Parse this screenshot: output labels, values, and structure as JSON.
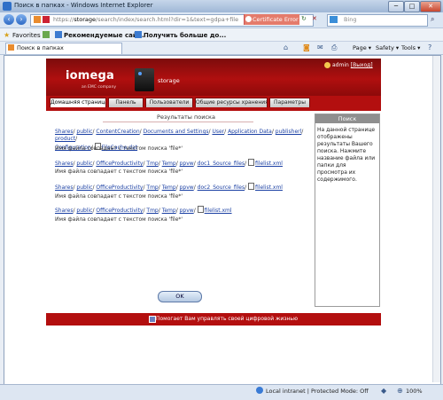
{
  "window": {
    "title": "Поиск в папках - Windows Internet Explorer",
    "minimize": "─",
    "maximize": "□",
    "close": "✕"
  },
  "address_bar": {
    "url_prefix": "https://",
    "url_host": "storage",
    "url_rest": "/search/index/search.html?dir=1&text=gdpa+file",
    "cert_error": "Certificate Error",
    "search_placeholder": "Bing"
  },
  "favorites_bar": {
    "favorites": "Favorites",
    "item1": "Рекомендуемые сай...",
    "item2": "Получить больше до..."
  },
  "tab": {
    "title": "Поиск в папках"
  },
  "toolbar_right": {
    "page": "Page ▾",
    "safety": "Safety ▾",
    "tools": "Tools ▾"
  },
  "header": {
    "logo": "iomega",
    "logo_sub": "an EMC company",
    "device_name": "storage",
    "user": "admin",
    "logout": "[Выход]"
  },
  "nav_tabs": [
    "Домашняя страница",
    "Панель",
    "Пользователи",
    "Общие ресурсы хранения",
    "Параметры"
  ],
  "results": {
    "title": "Результаты поиска",
    "match_text": "Имя файла совпадает с текстом поиска 'file*'",
    "r1_line1": [
      "Shares",
      "public",
      "ContentCreation",
      "Documents and Settings",
      "User",
      "Application Data",
      "publisherl",
      "product"
    ],
    "r1_line2": [
      "Configuration"
    ],
    "r1_file": "FileCache.dat",
    "r2_path": [
      "Shares",
      "public",
      "OfficeProductivity",
      "Tmp",
      "Temp",
      "ppvw",
      "doc1_Source_files"
    ],
    "r2_file": "filelist.xml",
    "r3_path": [
      "Shares",
      "public",
      "OfficeProductivity",
      "Tmp",
      "Temp",
      "ppvw",
      "doc2_Source_files"
    ],
    "r3_file": "filelist.xml",
    "r4_path": [
      "Shares",
      "public",
      "OfficeProductivity",
      "Tmp",
      "Temp",
      "ppvw"
    ],
    "r4_file": "filelist.xml",
    "ok": "OK"
  },
  "help": {
    "title": "Поиск",
    "text": "На данной странице отображены результаты Вашего поиска. Нажмите название файла или папки для просмотра их содержимого."
  },
  "footer": {
    "text": "Помогает Вам управлять своей цифровой жизнью"
  },
  "status_bar": {
    "zone": "Local intranet | Protected Mode: Off",
    "zoom": "100%"
  }
}
